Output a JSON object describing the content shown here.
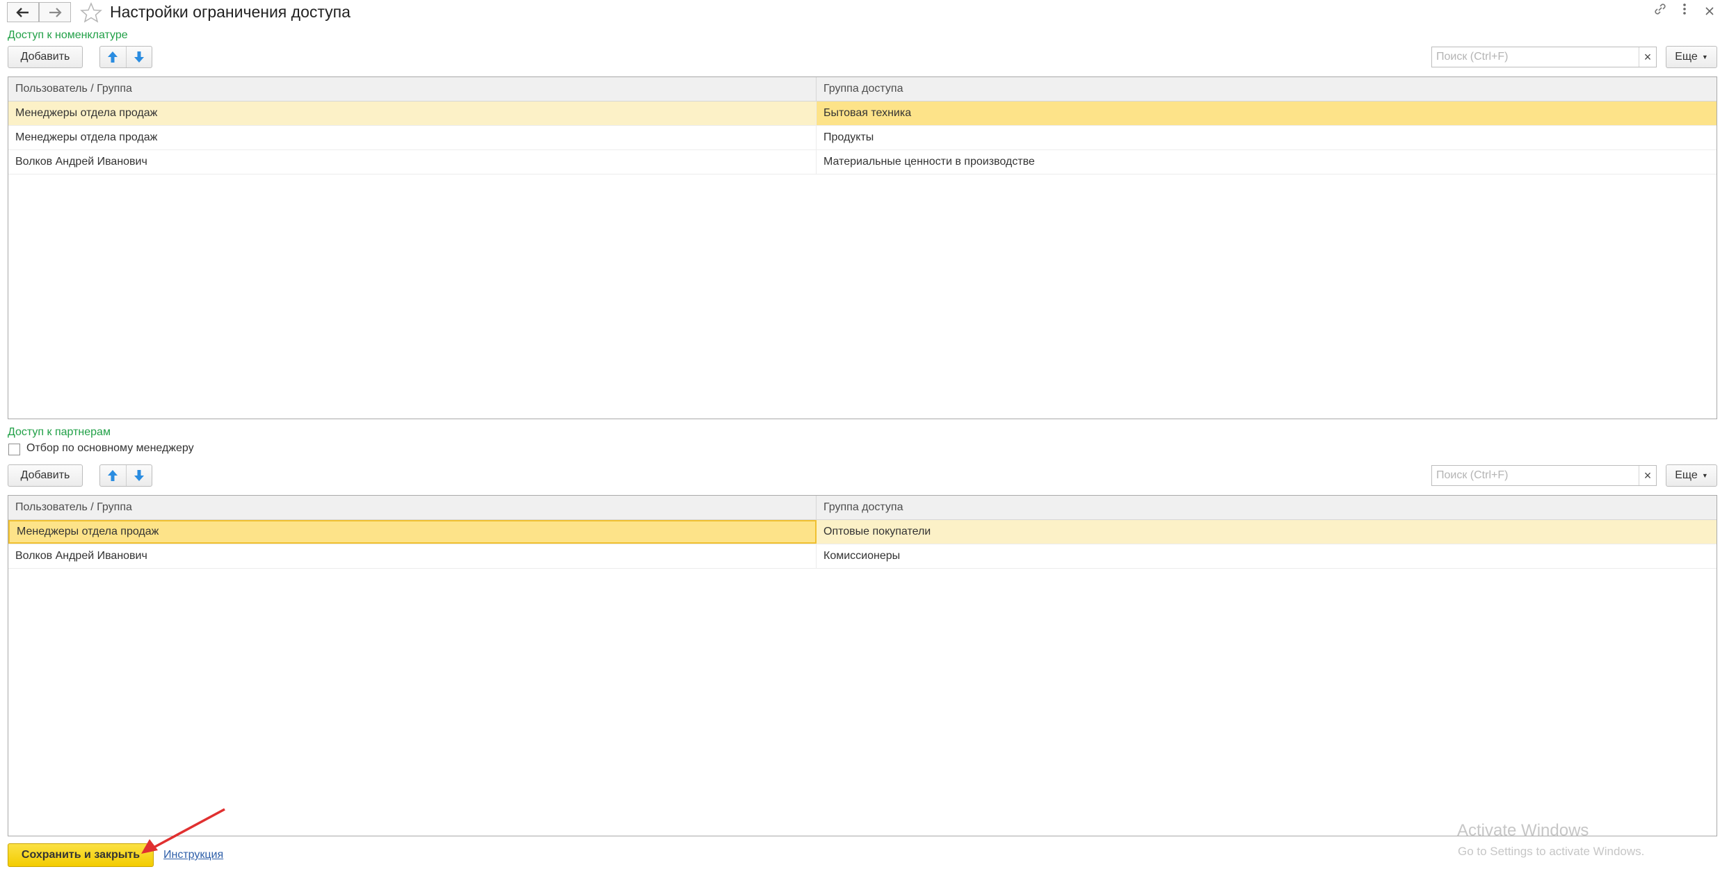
{
  "window": {
    "title": "Настройки ограничения доступа",
    "back_icon": "arrow-left-icon",
    "forward_icon": "arrow-right-icon",
    "favorite_icon": "star-icon",
    "link_icon": "link-icon",
    "menu_icon": "more-vertical-icon",
    "close_icon": "close-icon"
  },
  "nomenclature": {
    "label": "Доступ к номенклатуре",
    "add_label": "Добавить",
    "search_placeholder": "Поиск (Ctrl+F)",
    "search_clear": "×",
    "more_label": "Еще",
    "columns": [
      "Пользователь / Группа",
      "Группа доступа"
    ],
    "rows": [
      {
        "user": "Менеджеры отдела продаж",
        "group": "Бытовая техника"
      },
      {
        "user": "Менеджеры отдела продаж",
        "group": "Продукты"
      },
      {
        "user": "Волков Андрей Иванович",
        "group": "Материальные ценности в производстве"
      }
    ]
  },
  "partners": {
    "label": "Доступ к партнерам",
    "filter_label": "Отбор по основному менеджеру",
    "filter_checked": false,
    "add_label": "Добавить",
    "search_placeholder": "Поиск (Ctrl+F)",
    "search_clear": "×",
    "more_label": "Еще",
    "columns": [
      "Пользователь / Группа",
      "Группа доступа"
    ],
    "rows": [
      {
        "user": "Менеджеры отдела продаж",
        "group": "Оптовые покупатели"
      },
      {
        "user": "Волков Андрей Иванович",
        "group": "Комиссионеры"
      }
    ]
  },
  "footer": {
    "save_label": "Сохранить и закрыть",
    "help_link": "Инструкция"
  },
  "watermark": {
    "line1": "Activate Windows",
    "line2": "Go to Settings to activate Windows."
  },
  "colors": {
    "accent_green": "#21a047",
    "selected_row": "#fcf1c7",
    "selected_cell": "#fde389",
    "save_button": "#f3cc00",
    "annotation_arrow": "#e03030"
  }
}
